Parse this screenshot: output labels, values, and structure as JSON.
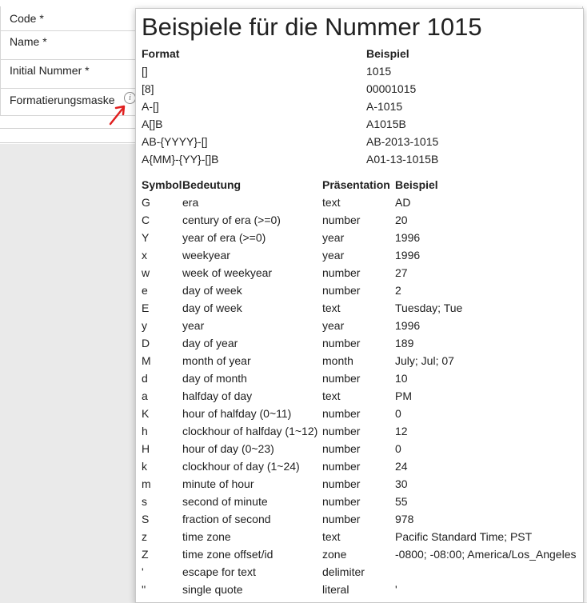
{
  "form": {
    "fields": [
      {
        "label": "Code",
        "required": "*"
      },
      {
        "label": "Name",
        "required": "*"
      },
      {
        "label": "Initial Nummer",
        "required": "*"
      },
      {
        "label": "Formatierungsmaske"
      }
    ],
    "info_icon": "info-icon",
    "info_glyph": "i"
  },
  "popover": {
    "title": "Beispiele für die Nummer 1015",
    "examples_header": {
      "format": "Format",
      "example": "Beispiel"
    },
    "examples": [
      {
        "format": "[]",
        "example": "1015"
      },
      {
        "format": "[8]",
        "example": "00001015"
      },
      {
        "format": "A-[]",
        "example": "A-1015"
      },
      {
        "format": "A[]B",
        "example": "A1015B"
      },
      {
        "format": "AB-{YYYY}-[]",
        "example": "AB-2013-1015"
      },
      {
        "format": "A{MM}-{YY}-[]B",
        "example": "A01-13-1015B"
      }
    ],
    "symbols_header": {
      "symbol": "Symbol",
      "meaning": "Bedeutung",
      "presentation": "Präsentation",
      "example": "Beispiel"
    },
    "symbols": [
      {
        "symbol": "G",
        "meaning": "era",
        "presentation": "text",
        "example": "AD"
      },
      {
        "symbol": "C",
        "meaning": "century of era (>=0)",
        "presentation": "number",
        "example": "20"
      },
      {
        "symbol": "Y",
        "meaning": "year of era (>=0)",
        "presentation": "year",
        "example": "1996"
      },
      {
        "symbol": "x",
        "meaning": "weekyear",
        "presentation": "year",
        "example": "1996"
      },
      {
        "symbol": "w",
        "meaning": "week of weekyear",
        "presentation": "number",
        "example": "27"
      },
      {
        "symbol": "e",
        "meaning": "day of week",
        "presentation": "number",
        "example": "2"
      },
      {
        "symbol": "E",
        "meaning": "day of week",
        "presentation": "text",
        "example": "Tuesday; Tue"
      },
      {
        "symbol": "y",
        "meaning": "year",
        "presentation": "year",
        "example": "1996"
      },
      {
        "symbol": "D",
        "meaning": "day of year",
        "presentation": "number",
        "example": "189"
      },
      {
        "symbol": "M",
        "meaning": "month of year",
        "presentation": "month",
        "example": "July; Jul; 07"
      },
      {
        "symbol": "d",
        "meaning": "day of month",
        "presentation": "number",
        "example": "10"
      },
      {
        "symbol": "a",
        "meaning": "halfday of day",
        "presentation": "text",
        "example": "PM"
      },
      {
        "symbol": "K",
        "meaning": "hour of halfday (0~11)",
        "presentation": "number",
        "example": "0"
      },
      {
        "symbol": "h",
        "meaning": "clockhour of halfday (1~12)",
        "presentation": "number",
        "example": "12"
      },
      {
        "symbol": "H",
        "meaning": "hour of day (0~23)",
        "presentation": "number",
        "example": "0"
      },
      {
        "symbol": "k",
        "meaning": "clockhour of day (1~24)",
        "presentation": "number",
        "example": "24"
      },
      {
        "symbol": "m",
        "meaning": "minute of hour",
        "presentation": "number",
        "example": "30"
      },
      {
        "symbol": "s",
        "meaning": "second of minute",
        "presentation": "number",
        "example": "55"
      },
      {
        "symbol": "S",
        "meaning": "fraction of second",
        "presentation": "number",
        "example": "978"
      },
      {
        "symbol": "z",
        "meaning": "time zone",
        "presentation": "text",
        "example": "Pacific Standard Time; PST"
      },
      {
        "symbol": "Z",
        "meaning": "time zone offset/id",
        "presentation": "zone",
        "example": "-0800; -08:00; America/Los_Angeles"
      },
      {
        "symbol": "'",
        "meaning": "escape for text",
        "presentation": "delimiter",
        "example": ""
      },
      {
        "symbol": "''",
        "meaning": "single quote",
        "presentation": "literal",
        "example": "'"
      }
    ]
  },
  "colors": {
    "annotation_arrow": "#e02020"
  }
}
